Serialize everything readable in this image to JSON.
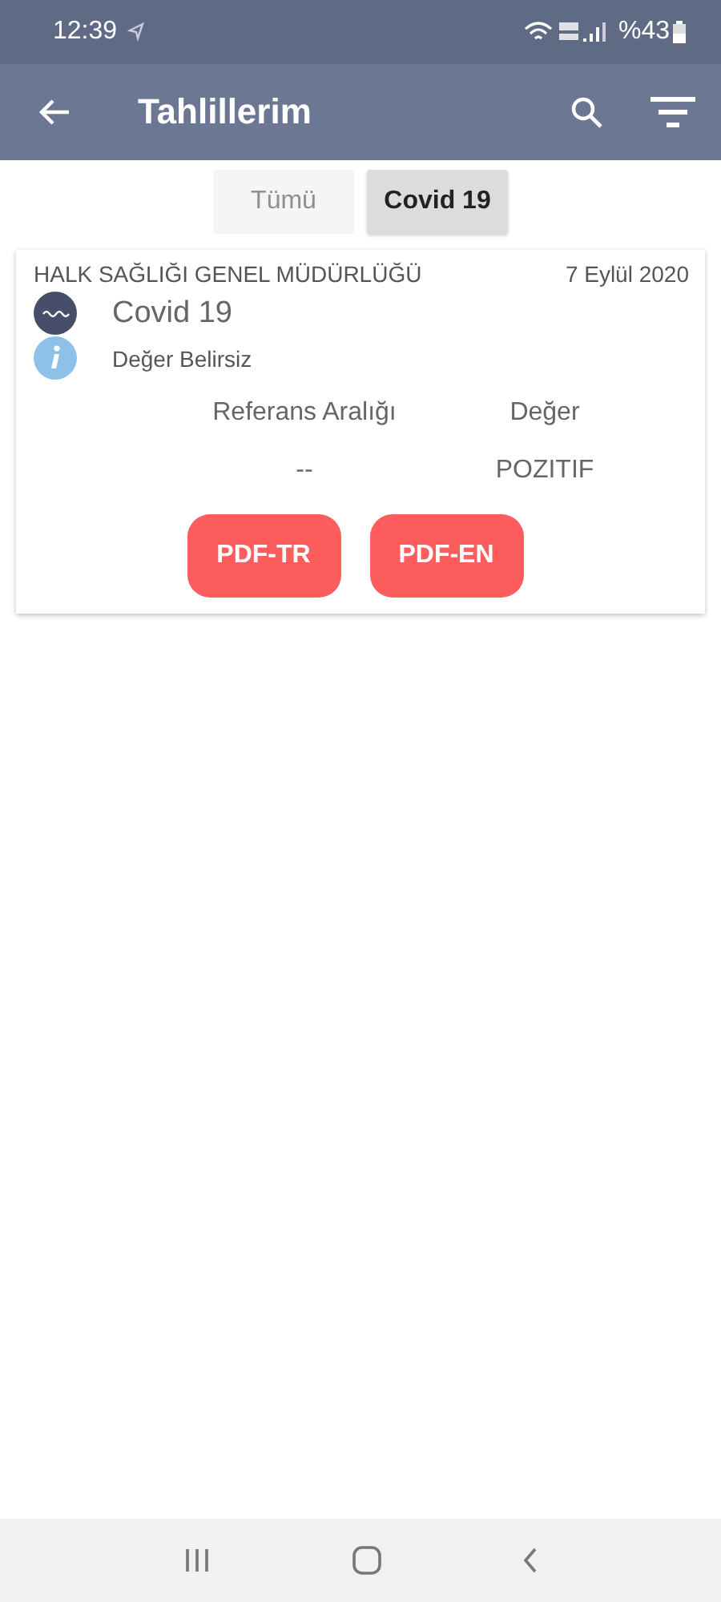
{
  "status_bar": {
    "time": "12:39",
    "battery": "%43"
  },
  "app_bar": {
    "title": "Tahlillerim"
  },
  "filters": [
    {
      "label": "Tümü",
      "selected": false
    },
    {
      "label": "Covid 19",
      "selected": true
    }
  ],
  "results": [
    {
      "institution": "HALK SAĞLIĞI GENEL MÜDÜRLÜĞÜ",
      "date": "7 Eylül 2020",
      "test": "Covid 19",
      "note": "Değer Belirsiz",
      "columns": [
        "Referans Aralığı",
        "Değer"
      ],
      "row": [
        "--",
        "POZITIF"
      ],
      "buttons": [
        "PDF-TR",
        "PDF-EN"
      ]
    }
  ]
}
